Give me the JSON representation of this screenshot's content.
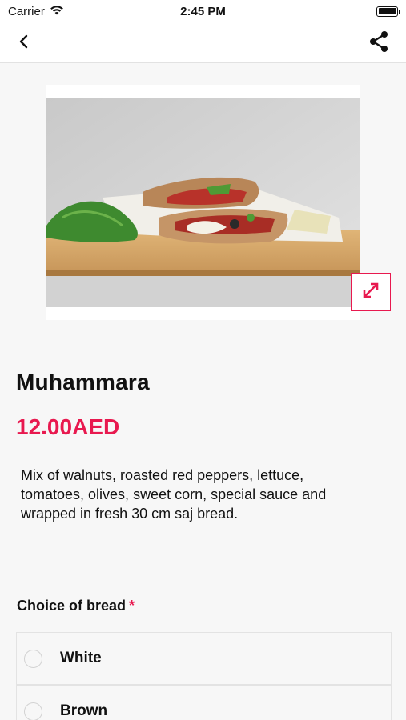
{
  "status_bar": {
    "carrier": "Carrier",
    "time": "2:45 PM",
    "wifi_icon": "wifi-icon",
    "battery_icon": "battery-icon"
  },
  "nav": {
    "back_icon": "chevron-left-icon",
    "share_icon": "share-icon"
  },
  "product": {
    "name": "Muhammara",
    "price": "12.00AED",
    "description": "Mix of walnuts, roasted red peppers, lettuce, tomatoes, olives, sweet corn, special sauce and wrapped in fresh 30 cm saj bread.",
    "image_icon": "food-photo",
    "expand_icon": "expand-icon"
  },
  "options": {
    "title": "Choice of bread",
    "required_mark": "*",
    "items": [
      {
        "label": "White",
        "selected": false
      },
      {
        "label": "Brown",
        "selected": false
      }
    ]
  },
  "colors": {
    "accent": "#e8194f",
    "background": "#f7f7f7",
    "surface": "#ffffff"
  }
}
